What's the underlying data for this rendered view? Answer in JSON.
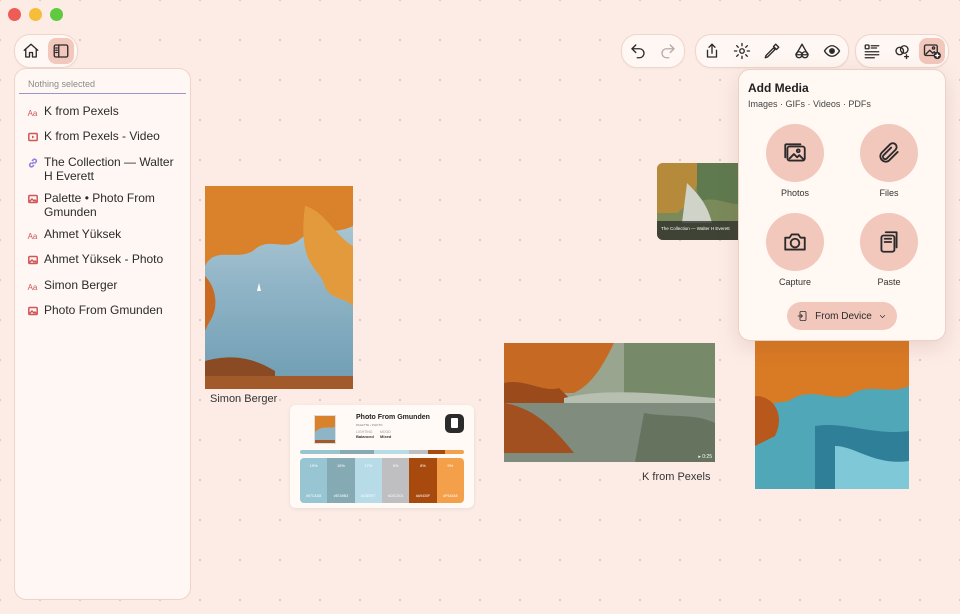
{
  "sidebar": {
    "header": "Nothing selected",
    "items": [
      {
        "icon": "text-icon",
        "glyph": "Aa",
        "label": "K from Pexels"
      },
      {
        "icon": "video-icon",
        "glyph": "",
        "label": "K from Pexels - Video"
      },
      {
        "icon": "link-icon",
        "glyph": "",
        "label": "The Collection — Walter H Everett"
      },
      {
        "icon": "image-icon",
        "glyph": "",
        "label": "Palette • Photo From Gmunden"
      },
      {
        "icon": "text-icon",
        "glyph": "Aa",
        "label": "Ahmet Yüksek"
      },
      {
        "icon": "image-icon",
        "glyph": "",
        "label": "Ahmet Yüksek - Photo"
      },
      {
        "icon": "text-icon",
        "glyph": "Aa",
        "label": "Simon Berger"
      },
      {
        "icon": "image-icon",
        "glyph": "",
        "label": "Photo From Gmunden"
      }
    ]
  },
  "canvas": {
    "simon_caption": "Simon Berger",
    "kpexels_caption": "K from Pexels",
    "collection_caption": "The Collection — Walter H Everett",
    "video_badge": "▸ 0:25",
    "palette": {
      "title": "Photo From Gmunden",
      "subtitle": "PALETTE • PHOTO",
      "meta1_label": "LIGHTING",
      "meta1_value": "Balanced",
      "meta2_label": "MOOD",
      "meta2_value": "Mixed",
      "swatches": [
        {
          "pct": "19%",
          "hex": "#97CAD8",
          "color": "#97c6d2"
        },
        {
          "pct": "16%",
          "hex": "#87A9B3",
          "color": "#86aab3"
        },
        {
          "pct": "17%",
          "hex": "#C3E0F7",
          "color": "#b8dbe8"
        },
        {
          "pct": "9%",
          "hex": "#C0C0C4",
          "color": "#bfbfc2"
        },
        {
          "pct": "8%",
          "hex": "#A9430F",
          "color": "#a84a0e"
        },
        {
          "pct": "9%",
          "hex": "#F9A348",
          "color": "#f4a04a"
        }
      ]
    }
  },
  "popover": {
    "title": "Add Media",
    "subtitle": "Images · GIFs · Videos · PDFs",
    "options": [
      "Photos",
      "Files",
      "Capture",
      "Paste"
    ],
    "from_device": "From Device"
  },
  "colors": {
    "background": "#fdece6",
    "accent": "#f2c7bc",
    "panel": "#fff7f3"
  }
}
